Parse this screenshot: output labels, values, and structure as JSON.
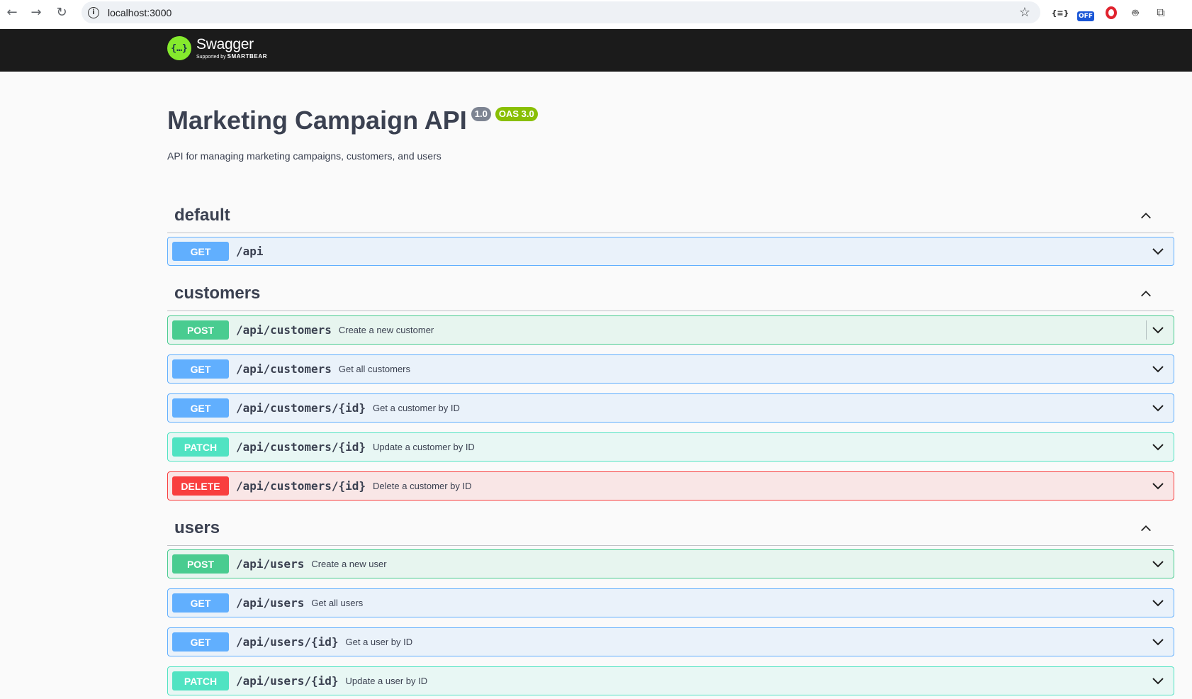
{
  "browser": {
    "url": "localhost:3000",
    "extensions": [
      "braces-icon",
      "off-badge",
      "opera-icon",
      "robot-icon",
      "puzzle-icon"
    ],
    "off_label": "OFF"
  },
  "topbar": {
    "logo_name": "Swagger",
    "logo_supported": "Supported by",
    "logo_brand": "SMARTBEAR"
  },
  "info": {
    "title": "Marketing Campaign API",
    "version": "1.0",
    "oas": "OAS 3.0",
    "description": "API for managing marketing campaigns, customers, and users"
  },
  "sections": [
    {
      "name": "default",
      "ops": [
        {
          "method": "GET",
          "path": "/api",
          "summary": ""
        }
      ]
    },
    {
      "name": "customers",
      "ops": [
        {
          "method": "POST",
          "path": "/api/customers",
          "summary": "Create a new customer"
        },
        {
          "method": "GET",
          "path": "/api/customers",
          "summary": "Get all customers"
        },
        {
          "method": "GET",
          "path": "/api/customers/{id}",
          "summary": "Get a customer by ID"
        },
        {
          "method": "PATCH",
          "path": "/api/customers/{id}",
          "summary": "Update a customer by ID"
        },
        {
          "method": "DELETE",
          "path": "/api/customers/{id}",
          "summary": "Delete a customer by ID"
        }
      ]
    },
    {
      "name": "users",
      "ops": [
        {
          "method": "POST",
          "path": "/api/users",
          "summary": "Create a new user"
        },
        {
          "method": "GET",
          "path": "/api/users",
          "summary": "Get all users"
        },
        {
          "method": "GET",
          "path": "/api/users/{id}",
          "summary": "Get a user by ID"
        },
        {
          "method": "PATCH",
          "path": "/api/users/{id}",
          "summary": "Update a user by ID"
        }
      ]
    }
  ],
  "colors": {
    "get": "#61affe",
    "post": "#49cc90",
    "patch": "#50e3c2",
    "delete": "#f93e3e",
    "topbar": "#1b1b1b",
    "logo_green": "#85ea2d",
    "oas_badge": "#89bf04"
  }
}
